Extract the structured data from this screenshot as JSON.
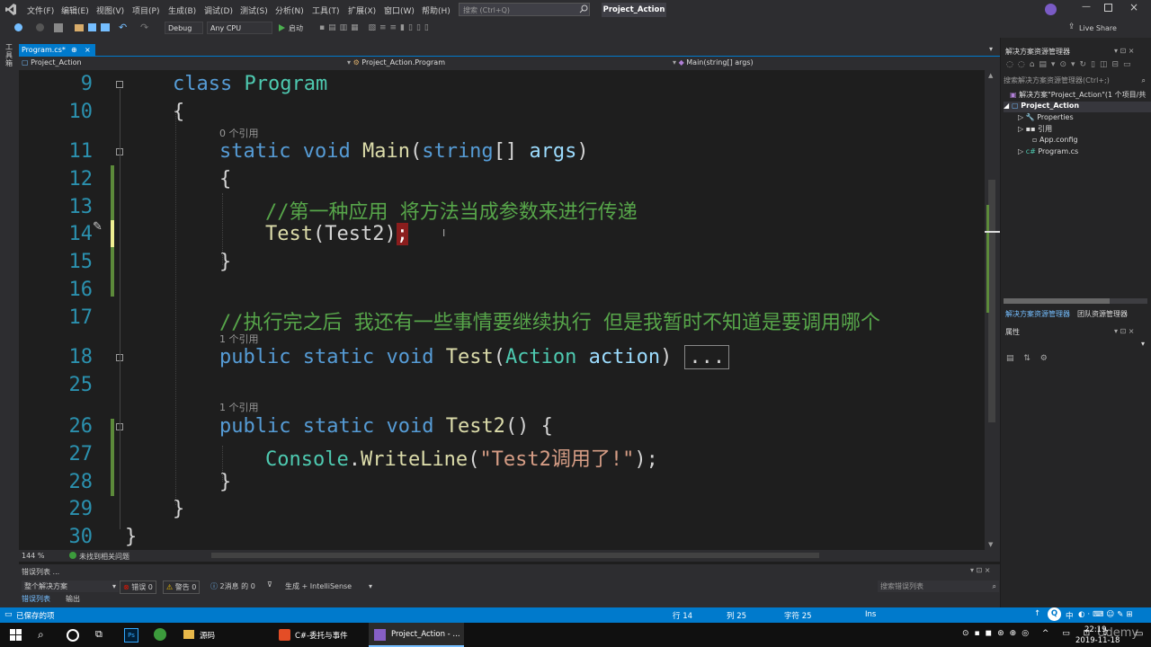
{
  "colors": {
    "accent": "#007acc",
    "keyword": "#569cd6",
    "type": "#4ec9b0",
    "comment": "#57a64a",
    "string": "#d69d85",
    "linenum": "#2b91af"
  },
  "titlebar": {
    "menus": [
      "文件(F)",
      "编辑(E)",
      "视图(V)",
      "项目(P)",
      "生成(B)",
      "调试(D)",
      "测试(S)",
      "分析(N)",
      "工具(T)",
      "扩展(X)",
      "窗口(W)",
      "帮助(H)"
    ],
    "search_placeholder": "搜索 (Ctrl+Q)",
    "project": "Project_Action",
    "live_share": "Live Share"
  },
  "toolbar": {
    "config": "Debug",
    "platform": "Any CPU",
    "start": "启动"
  },
  "left_strip_label": "工具箱",
  "doc_tab": {
    "label": "Program.cs*",
    "pin": "⊕",
    "close": "×"
  },
  "navbar": {
    "project": "Project_Action",
    "class": "Project_Action.Program",
    "member": "Main(string[] args)"
  },
  "editor": {
    "lines": [
      {
        "n": "9",
        "tokens": [
          [
            "kw",
            "class"
          ],
          [
            "",
            " "
          ],
          [
            "ty",
            "Program"
          ]
        ]
      },
      {
        "n": "10",
        "tokens": [
          [
            "",
            "{"
          ]
        ]
      },
      {
        "n": "11",
        "tokens": [
          [
            "kw",
            "static"
          ],
          [
            "",
            " "
          ],
          [
            "kw",
            "void"
          ],
          [
            "",
            " "
          ],
          [
            "fn",
            "Main"
          ],
          [
            "",
            "("
          ],
          [
            "kw",
            "string"
          ],
          [
            "",
            "[] "
          ],
          [
            "pa",
            "args"
          ],
          [
            "",
            ")"
          ]
        ]
      },
      {
        "n": "12",
        "tokens": [
          [
            "",
            "{"
          ]
        ]
      },
      {
        "n": "13",
        "tokens": [
          [
            "cm",
            "//第一种应用 将方法当成参数来进行传递"
          ]
        ]
      },
      {
        "n": "14",
        "tokens": [
          [
            "fn",
            "Test"
          ],
          [
            "",
            "(Test2)"
          ],
          [
            "err",
            ";"
          ]
        ]
      },
      {
        "n": "15",
        "tokens": [
          [
            "",
            "}"
          ]
        ]
      },
      {
        "n": "16",
        "tokens": []
      },
      {
        "n": "17",
        "tokens": [
          [
            "cm",
            "//执行完之后 我还有一些事情要继续执行 但是我暂时不知道是要调用哪个"
          ]
        ]
      },
      {
        "n": "18",
        "tokens": [
          [
            "kw",
            "public"
          ],
          [
            "",
            " "
          ],
          [
            "kw",
            "static"
          ],
          [
            "",
            " "
          ],
          [
            "kw",
            "void"
          ],
          [
            "",
            " "
          ],
          [
            "fn",
            "Test"
          ],
          [
            "",
            "("
          ],
          [
            "ty",
            "Action"
          ],
          [
            "",
            " "
          ],
          [
            "pa",
            "action"
          ],
          [
            "",
            ")"
          ]
        ]
      },
      {
        "n": "25",
        "tokens": []
      },
      {
        "n": "26",
        "tokens": [
          [
            "kw",
            "public"
          ],
          [
            "",
            " "
          ],
          [
            "kw",
            "static"
          ],
          [
            "",
            " "
          ],
          [
            "kw",
            "void"
          ],
          [
            "",
            " "
          ],
          [
            "fn",
            "Test2"
          ],
          [
            "",
            "() {"
          ]
        ]
      },
      {
        "n": "27",
        "tokens": [
          [
            "ty",
            "Console"
          ],
          [
            "",
            "."
          ],
          [
            "fn",
            "WriteLine"
          ],
          [
            "",
            "("
          ],
          [
            "st",
            "\"Test2调用了!\""
          ],
          [
            "",
            ");"
          ]
        ]
      },
      {
        "n": "28",
        "tokens": [
          [
            "",
            "}"
          ]
        ]
      },
      {
        "n": "29",
        "tokens": [
          [
            "",
            "}"
          ]
        ]
      },
      {
        "n": "30",
        "tokens": [
          [
            "",
            "}"
          ]
        ]
      }
    ],
    "lens_0": "0 个引用",
    "lens_1": "1 个引用",
    "lens_2": "1 个引用",
    "collapsed": "...",
    "zoom": "144 %",
    "no_issues": "未找到相关问题"
  },
  "error_list": {
    "title": "错误列表 ...",
    "scope": "整个解决方案",
    "errors": "错误 0",
    "warnings": "警告 0",
    "messages": "2消息 的 0",
    "build": "生成 + IntelliSense",
    "search_placeholder": "搜索错误列表",
    "tab_errors": "错误列表",
    "tab_output": "输出"
  },
  "solution": {
    "title": "解决方案资源管理器",
    "search_placeholder": "搜索解决方案资源管理器(Ctrl+;)",
    "root": "解决方案\"Project_Action\"(1 个项目/共",
    "project": "Project_Action",
    "items": [
      "Properties",
      "引用",
      "App.config",
      "Program.cs"
    ],
    "tab_sol": "解决方案资源管理器",
    "tab_team": "团队资源管理器",
    "props_title": "属性"
  },
  "statusbar": {
    "saved": "已保存的项",
    "row": "行 14",
    "col": "列 25",
    "char": "字符 25",
    "ins": "Ins"
  },
  "taskbar": {
    "apps": [
      "源码",
      "C#-委托与事件",
      "Project_Action - ..."
    ],
    "time": "22:19",
    "date": "2019-11-18",
    "ime": "中",
    "watermark": "Udemy"
  }
}
